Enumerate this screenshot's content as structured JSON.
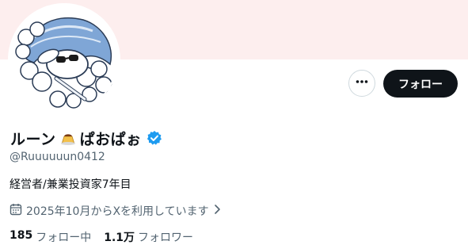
{
  "colors": {
    "banner": "#fdeeee",
    "accent": "#1d9bf0",
    "follow_bg": "#0f1419",
    "secondary_text": "#536471"
  },
  "header": {
    "more_icon": "more-horizontal-icon",
    "follow_label": "フォロー"
  },
  "profile": {
    "display_name_left": "ルーン",
    "name_emoji": "pudding-icon",
    "display_name_right": "ぱおぱぉ",
    "verified_icon": "verified-badge-icon",
    "handle": "@Ruuuuuun0412",
    "bio": "経営者/兼業投資家7年目",
    "joined_text": "2025年10月からXを利用しています",
    "joined_icon": "calendar-icon"
  },
  "stats": {
    "following_count": "185",
    "following_label": "フォロー中",
    "followers_count": "1.1万",
    "followers_label": "フォロワー"
  }
}
